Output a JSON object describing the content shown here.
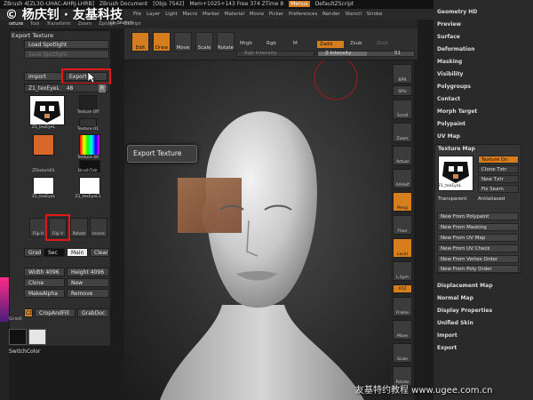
{
  "title_bar": {
    "app": "ZBrush 4[ZL3O-UHAC-AHRJ-LHRB]",
    "doc": "ZBrush Document",
    "obj": "[Objs 7542]",
    "mem": "Mem+1025+143 Free 374 ZTime 8",
    "menus": "Menus",
    "script": "DefaultZScript"
  },
  "menu_bar": [
    "Tool",
    "Transp",
    "Zoom",
    "Zplugin",
    "Zscript"
  ],
  "menu_bar_right": [
    "File",
    "Layer",
    "Light",
    "Macro",
    "Marker",
    "Material",
    "Movie",
    "Picker",
    "Preferences",
    "Render",
    "Stencil",
    "Stroke"
  ],
  "menu_bar2": [
    "Texture",
    "Tool",
    "Transform",
    "Zoom",
    "Zplugin",
    "Zscript"
  ],
  "toolbar": {
    "quick_sketch": "ick Sketch",
    "edit": "Edit",
    "draw": "Draw",
    "move": "Move",
    "scale": "Scale",
    "rotate": "Rotate",
    "mrgb": "Mrgb",
    "rgb": "Rgb",
    "m": "M",
    "zadd": "Zadd",
    "zsub": "Zsub",
    "zcut": "Zcut",
    "rgb_intensity_label": "Rgb Intensity",
    "z_intensity_label": "Z Intensity",
    "z_intensity_value": "51",
    "z_intensity_fraction": 0.51
  },
  "texture_panel": {
    "header": "Export Texture",
    "load_spotlight": "Load Spotlight",
    "save_spotlight": "Save Spotlight",
    "import": "Import",
    "export": "Export",
    "current_texture": "Z1_texEyeL",
    "current_texture_num": "48",
    "r_label": "R",
    "thumbnails": [
      {
        "label": "Z1_texEyeL"
      },
      {
        "label": "Texture Off"
      },
      {
        "label": "Texture 01"
      },
      {
        "label": "Texture 40"
      },
      {
        "label": "ZTexture01"
      },
      {
        "label": "BrushTxtr"
      },
      {
        "label": "Z1_texEyeL"
      },
      {
        "label": "Z1_texEyeL1"
      }
    ],
    "tools": [
      "Flip H",
      "Flip V",
      "Rotate",
      "Inverz"
    ],
    "grad": "Grad",
    "sec": "Sec",
    "main": "Main",
    "clear": "Clear",
    "width_label": "Width",
    "width_value": "4096",
    "height_label": "Height",
    "height_value": "4096",
    "clone": "Clone",
    "new": "New",
    "make_alpha": "MakeAlpha",
    "remove": "Remove",
    "cd": "CD",
    "crop_and_fill": "CropAndFill",
    "grab_doc": "GrabDoc",
    "switch_color": "SwitchColor",
    "gradient_label": "Gradi"
  },
  "tooltip": "Export Texture",
  "right_shelf": [
    "BPR",
    "SPix",
    "Scroll",
    "Zoom",
    "Actual",
    "AAHalf",
    "Persp",
    "Floor",
    "Local",
    "L.Sym",
    "XYZ",
    "Frame",
    "Move",
    "Scale",
    "Rotate"
  ],
  "right_panel": {
    "items_top": [
      "Geometry HD",
      "Preview",
      "Surface",
      "Deformation",
      "Masking",
      "Visibility",
      "Polygroups",
      "Contact",
      "Morph Target",
      "Polypaint",
      "UV Map"
    ],
    "texture_map": {
      "header": "Texture Map",
      "texture_on": "Texture On",
      "clone_txtr": "Clone Txtr",
      "new_txtr": "New Txtr",
      "fix_seam": "Fix Seam",
      "thumb_label": "Z1_texEyeL",
      "transparent": "Transparent",
      "antialiased": "Antialiased",
      "new_from": [
        "New From Polypaint",
        "New From Masking",
        "New From UV Map",
        "New From UV Check",
        "New From Vertex Order",
        "New From Poly Order"
      ]
    },
    "items_bottom": [
      "Displacement Map",
      "Normal Map",
      "Display Properties",
      "Unified Skin",
      "Import",
      "Export"
    ]
  },
  "watermark_top": "© 杨庆钊 · 友基科技",
  "watermark_bottom": "友基特约教程 www.ugee.com.cn",
  "colors": {
    "accent": "#d67d1e",
    "highlight": "#e01818",
    "panel": "#2e2e2e"
  }
}
